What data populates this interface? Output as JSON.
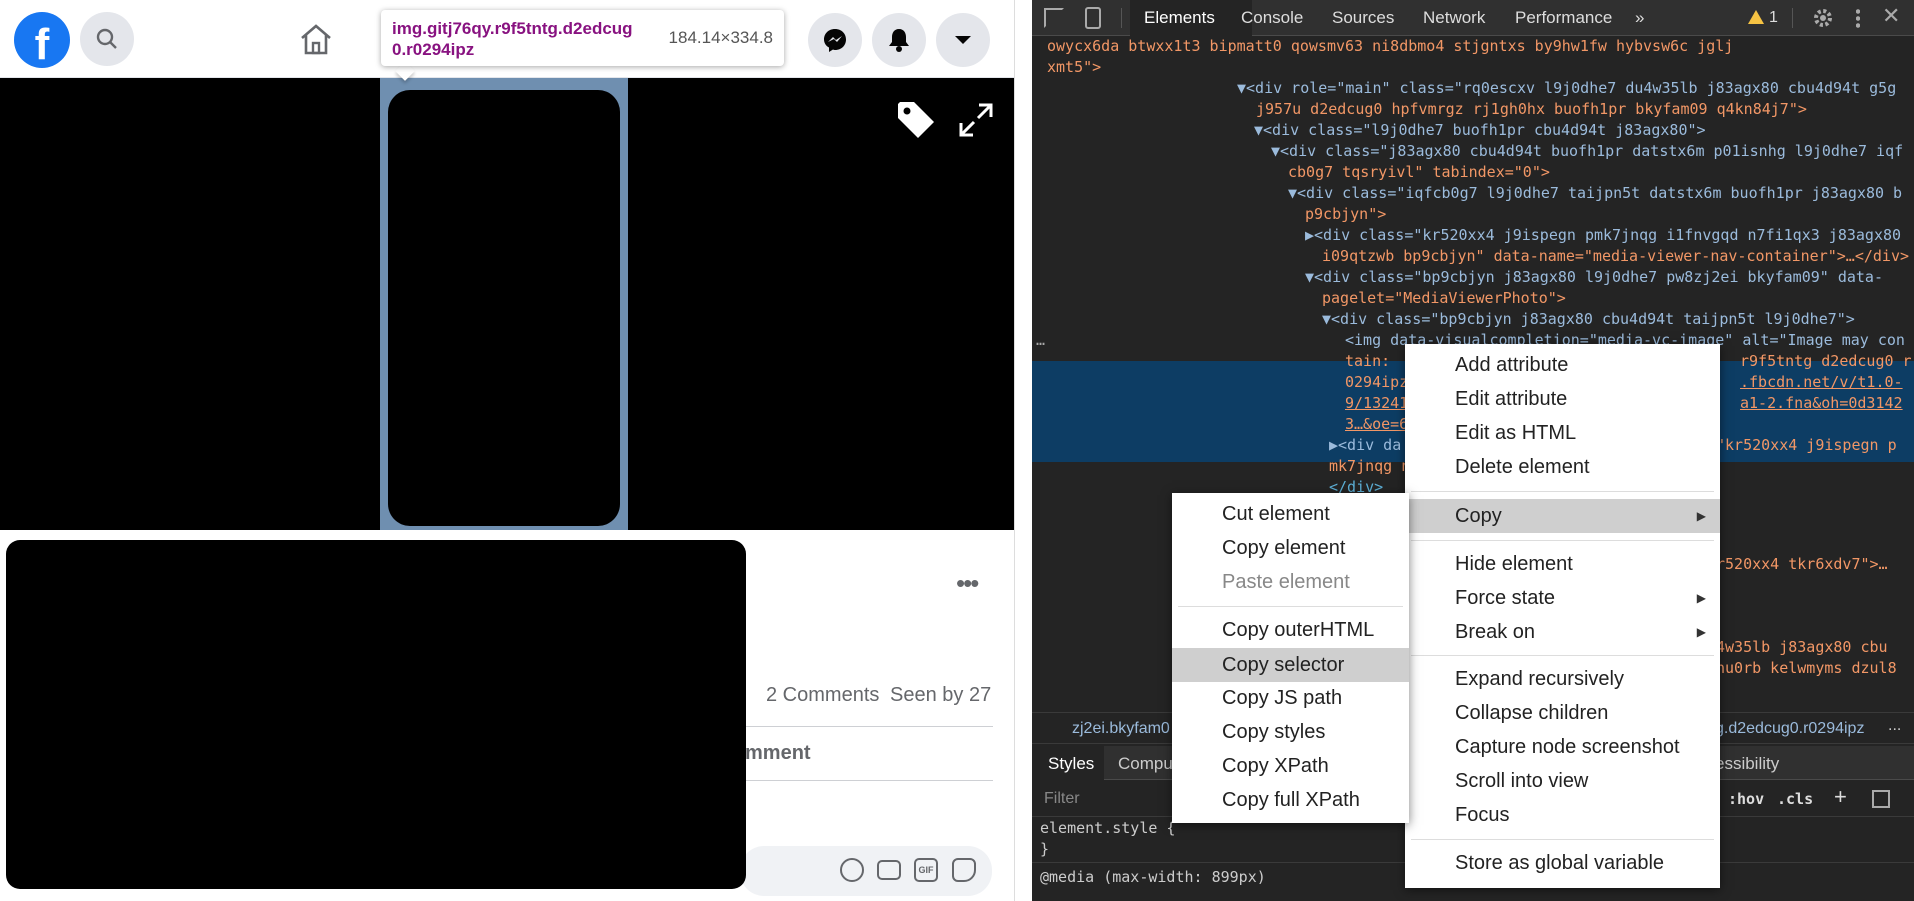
{
  "page": {
    "tooltip": {
      "selector": "img.gitj76qy.r9f5tntg.d2edcug0.r0294ipz",
      "dimensions": "184.14×334.8"
    },
    "post": {
      "comments": "2 Comments",
      "seen_by": "Seen by 27",
      "comment_partial": "mment"
    }
  },
  "devtools": {
    "tabs": [
      "Elements",
      "Console",
      "Sources",
      "Network",
      "Performance"
    ],
    "more_tabs": "»",
    "warnings": "1",
    "code_lines": [
      {
        "t": "owycx6da btwxx1t3 bipmatt0 qowsmv63 ni8dbmo4 stjgntxs by9hw1fw hybvsw6c jglj",
        "c": "av"
      },
      {
        "t": "xmt5\">",
        "c": "av"
      },
      {
        "t": "▼<div role=\"main\" class=\"rq0escxv l9j0dhe7 du4w35lb j83agx80 cbu4d94t g5g",
        "c": "mix"
      },
      {
        "t": "j957u d2edcug0 hpfvmrgz rj1gh0hx buofh1pr bkyfam09 q4kn84j7\">",
        "c": "av"
      },
      {
        "t": "▼<div class=\"l9j0dhe7 buofh1pr cbu4d94t j83agx80\">",
        "c": "mix"
      },
      {
        "t": "▼<div class=\"j83agx80 cbu4d94t buofh1pr datstx6m p01isnhg l9j0dhe7 iqf",
        "c": "mix"
      },
      {
        "t": "cb0g7 tqsryivl\" tabindex=\"0\">",
        "c": "av"
      },
      {
        "t": "▼<div class=\"iqfcb0g7 l9j0dhe7 taijpn5t datstx6m buofh1pr j83agx80 b",
        "c": "mix"
      },
      {
        "t": "p9cbjyn\">",
        "c": "av"
      },
      {
        "t": "▶<div class=\"kr520xx4 j9ispegn pmk7jnqg i1fnvgqd n7fi1qx3 j83agx80",
        "c": "mix"
      },
      {
        "t": "i09qtzwb bp9cbjyn\" data-name=\"media-viewer-nav-container\">…</div>",
        "c": "av"
      },
      {
        "t": "▼<div class=\"bp9cbjyn j83agx80 l9j0dhe7 pw8zj2ei bkyfam09\" data-",
        "c": "mix"
      },
      {
        "t": "pagelet=\"MediaViewerPhoto\">",
        "c": "av"
      },
      {
        "t": "▼<div class=\"bp9cbjyn j83agx80 cbu4d94t taijpn5t l9j0dhe7\">",
        "c": "mix"
      },
      {
        "t": "<img data-visualcompletion=\"media-vc-image\" alt=\"Image may con",
        "c": "mix"
      },
      {
        "t": "tain:",
        "c": "av"
      },
      {
        "t": "0294ipz",
        "c": "av"
      },
      {
        "t": "9/13241",
        "c": "av"
      },
      {
        "t": "3…&oe=6",
        "c": "av"
      },
      {
        "t": "▶<div da",
        "c": "mix"
      },
      {
        "t": "mk7jnqg n",
        "c": "av"
      },
      {
        "t": "</div>",
        "c": "tag"
      }
    ],
    "right_fragments": {
      "r1": "r9f5tntg d2edcug0 r",
      "r2": ".fbcdn.net/v/t1.0-",
      "r3": "a1-2.fna&oh=0d3142",
      "r4": "\"kr520xx4 j9ispegn p",
      "r5": "r520xx4 tkr6xdv7\">…",
      "r6": "4w35lb j83agx80 cbu",
      "r7": "hu0rb kelwmyms dzul8"
    },
    "breadcrumb": {
      "left": "zj2ei.bkyfam0",
      "right": "g.d2edcug0.r0294ipz",
      "more": "..."
    },
    "styles_tabs": {
      "styles": "Styles",
      "computed": "Comput",
      "accessibility": "essibility"
    },
    "filter": {
      "placeholder": "Filter",
      "hov": ":hov",
      "cls": ".cls"
    },
    "styles_code": [
      "element.style {",
      "}",
      "@media (max-width: 899px)"
    ]
  },
  "context_menu": {
    "items": [
      "Add attribute",
      "Edit attribute",
      "Edit as HTML",
      "Delete element",
      "Copy",
      "Hide element",
      "Force state",
      "Break on",
      "Expand recursively",
      "Collapse children",
      "Capture node screenshot",
      "Scroll into view",
      "Focus",
      "Store as global variable"
    ]
  },
  "copy_submenu": {
    "items": [
      "Cut element",
      "Copy element",
      "Paste element",
      "Copy outerHTML",
      "Copy selector",
      "Copy JS path",
      "Copy styles",
      "Copy XPath",
      "Copy full XPath"
    ]
  },
  "colors": {
    "facebook_blue": "#1877f2",
    "devtools_bg": "#242424",
    "selected_row": "#0d3d64",
    "menu_highlight": "#cfcfcf"
  }
}
